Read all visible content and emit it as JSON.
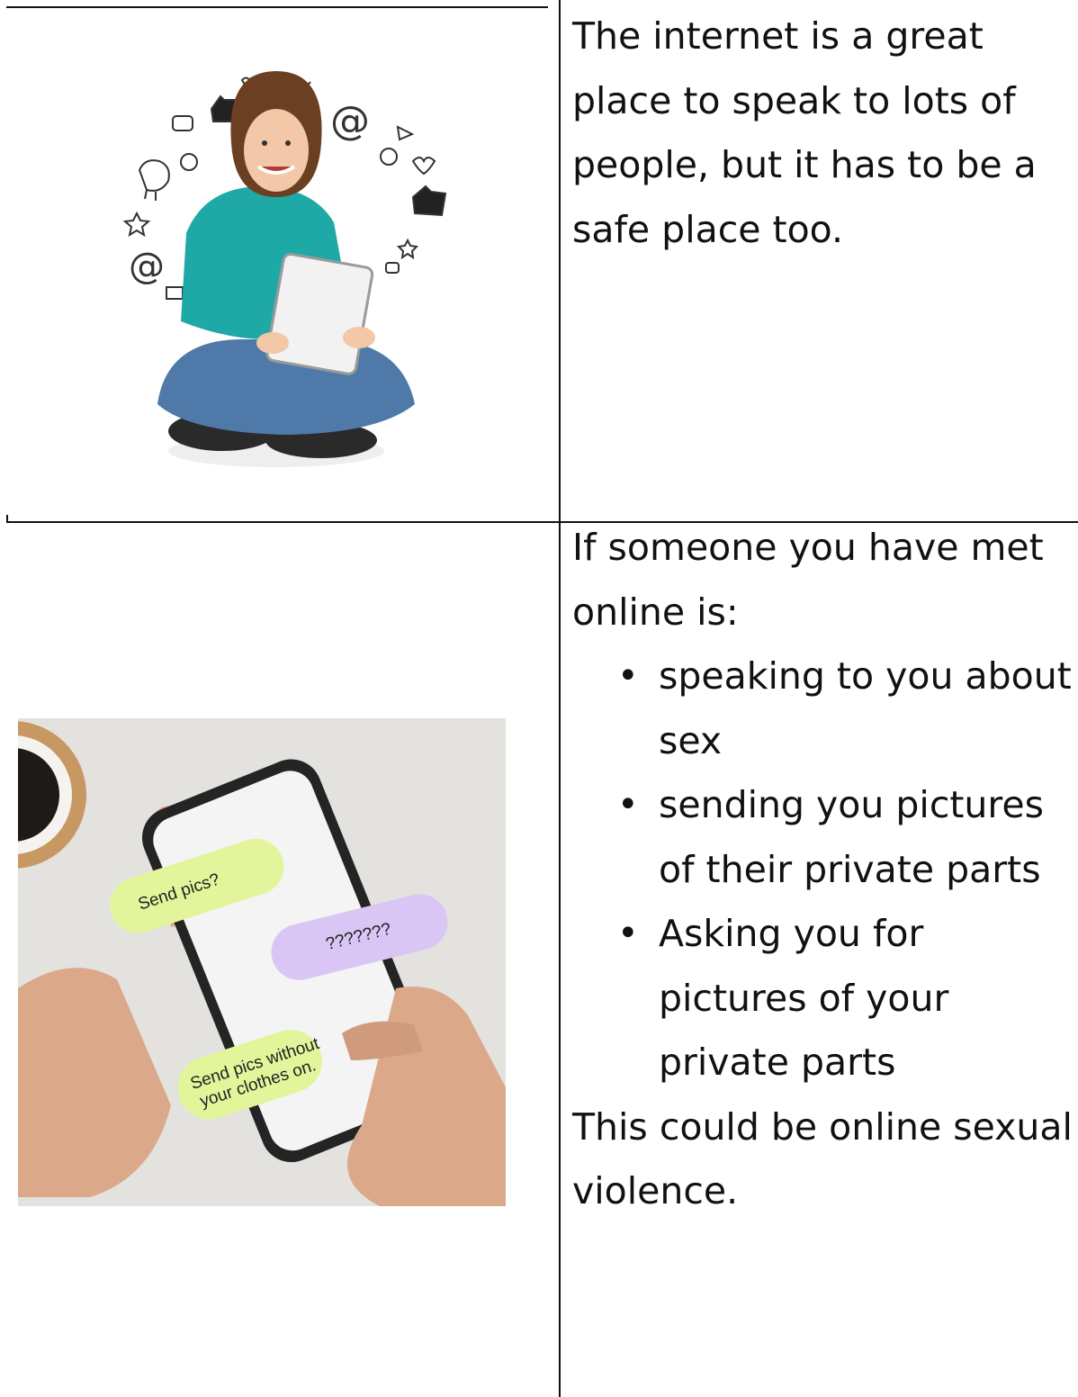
{
  "rows": [
    {
      "text": "The internet is a great place to speak to lots of people, but it has to be a safe place too."
    },
    {
      "intro": "If someone you have met online is:",
      "bullets": [
        "speaking to you about sex",
        "sending you pictures of their private parts",
        "Asking you for pictures of your private parts"
      ],
      "conclusion": "This could be online sexual violence."
    }
  ],
  "phone_messages": [
    "Send pics?",
    "???????",
    "Send pics without your clothes on."
  ],
  "colors": {
    "bubble_green": "#e2f59a",
    "bubble_purple": "#d9c6f5",
    "sweater": "#1fa9a6",
    "jeans": "#4f79a8"
  }
}
